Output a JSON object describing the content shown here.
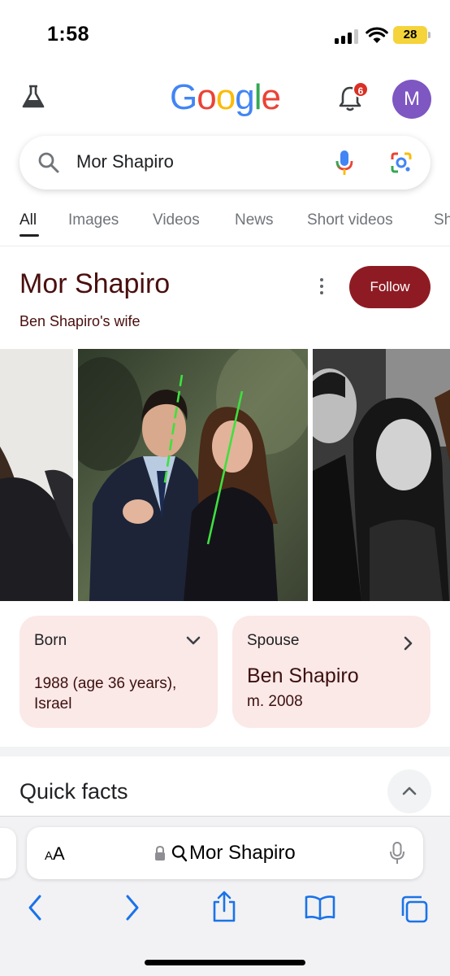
{
  "status_bar": {
    "time": "1:58",
    "battery": "28"
  },
  "header": {
    "logo_letters": [
      {
        "ch": "G",
        "color": "#4285F4"
      },
      {
        "ch": "o",
        "color": "#EA4335"
      },
      {
        "ch": "o",
        "color": "#FBBC05"
      },
      {
        "ch": "g",
        "color": "#4285F4"
      },
      {
        "ch": "l",
        "color": "#34A853"
      },
      {
        "ch": "e",
        "color": "#EA4335"
      }
    ],
    "notification_count": "6",
    "avatar_letter": "M",
    "icons": [
      "flask-icon",
      "bell-icon"
    ]
  },
  "search": {
    "query": "Mor Shapiro",
    "icons": [
      "search-icon",
      "mic-icon",
      "lens-icon"
    ]
  },
  "tabs": [
    "All",
    "Images",
    "Videos",
    "News",
    "Short videos",
    "Sh"
  ],
  "knowledge_panel": {
    "title": "Mor Shapiro",
    "subtitle": "Ben Shapiro's wife",
    "follow_label": "Follow",
    "born": {
      "label": "Born",
      "value": "1988 (age 36 years),",
      "place": "Israel"
    },
    "spouse": {
      "label": "Spouse",
      "name": "Ben Shapiro",
      "married": "m. 2008"
    }
  },
  "quick_facts": {
    "title": "Quick facts"
  },
  "safari": {
    "aa_small": "A",
    "aa_large": "A",
    "url_text": "Mor Shapiro",
    "toolbar": [
      "back-icon",
      "forward-icon",
      "share-icon",
      "bookmarks-icon",
      "tabs-icon"
    ]
  },
  "colors": {
    "accent": "#8e1b23",
    "card_bg": "#fbe9e7",
    "title": "#4a0e0e"
  }
}
